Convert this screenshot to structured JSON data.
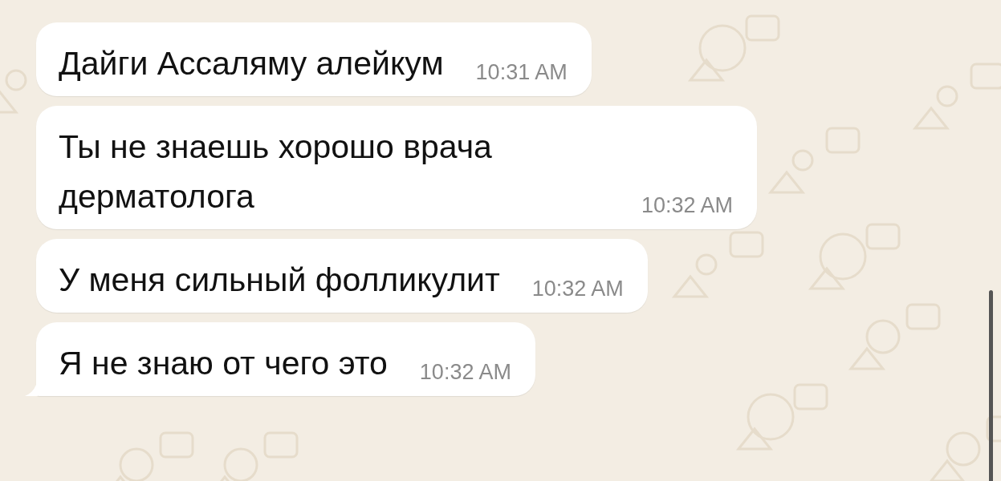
{
  "messages": [
    {
      "text": "Дайги Ассаляму алейкум",
      "time": "10:31 AM",
      "tail": false
    },
    {
      "text": "Ты не знаешь хорошо врача дерматолога",
      "time": "10:32 AM",
      "tail": false
    },
    {
      "text": "У меня сильный фолликулит",
      "time": "10:32 AM",
      "tail": false
    },
    {
      "text": "Я не знаю от чего это",
      "time": "10:32 AM",
      "tail": true
    }
  ]
}
